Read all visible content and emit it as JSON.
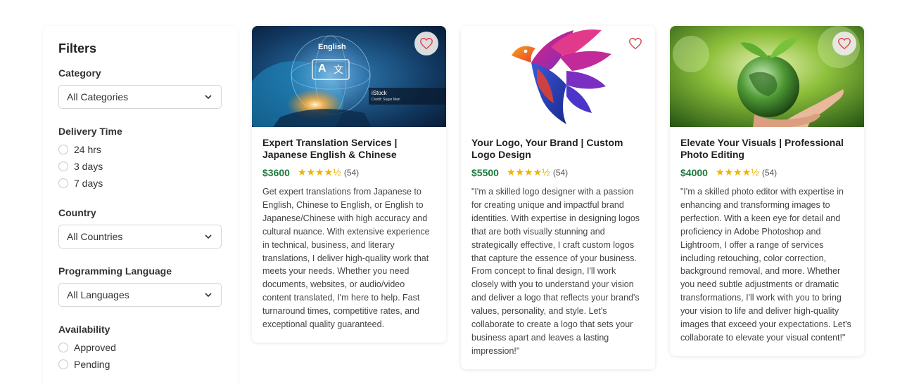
{
  "filters": {
    "title": "Filters",
    "category": {
      "label": "Category",
      "selected": "All Categories"
    },
    "delivery": {
      "label": "Delivery Time",
      "options": [
        "24 hrs",
        "3 days",
        "7 days"
      ]
    },
    "country": {
      "label": "Country",
      "selected": "All Countries"
    },
    "language": {
      "label": "Programming Language",
      "selected": "All Languages"
    },
    "availability": {
      "label": "Availability",
      "options": [
        "Approved",
        "Pending"
      ]
    }
  },
  "cards": [
    {
      "title": "Expert Translation Services | Japanese English & Chinese",
      "price": "$3600",
      "stars": "★★★★½",
      "reviews": "(54)",
      "description": "Get expert translations from Japanese to English, Chinese to English, or English to Japanese/Chinese with high accuracy and cultural nuance. With extensive experience in technical, business, and literary translations, I deliver high-quality work that meets your needs. Whether you need documents, websites, or audio/video content translated, I'm here to help. Fast turnaround times, competitive rates, and exceptional quality guaranteed.",
      "image_text": {
        "english": "English",
        "icon_a": "A",
        "icon_b": "文",
        "stock": "iStock",
        "credit": "Credit: Sugar Man"
      }
    },
    {
      "title": "Your Logo, Your Brand | Custom Logo Design",
      "price": "$5500",
      "stars": "★★★★½",
      "reviews": "(54)",
      "description": "\"I'm a skilled logo designer with a passion for creating unique and impactful brand identities. With expertise in designing logos that are both visually stunning and strategically effective, I craft custom logos that capture the essence of your business. From concept to final design, I'll work closely with you to understand your vision and deliver a logo that reflects your brand's values, personality, and style. Let's collaborate to create a logo that sets your business apart and leaves a lasting impression!\""
    },
    {
      "title": "Elevate Your Visuals | Professional Photo Editing",
      "price": "$4000",
      "stars": "★★★★½",
      "reviews": "(54)",
      "description": "\"I'm a skilled photo editor with expertise in enhancing and transforming images to perfection. With a keen eye for detail and proficiency in Adobe Photoshop and Lightroom, I offer a range of services including retouching, color correction, background removal, and more. Whether you need subtle adjustments or dramatic transformations, I'll work with you to bring your vision to life and deliver high-quality images that exceed your expectations. Let's collaborate to elevate your visual content!\""
    }
  ],
  "colors": {
    "price": "#1e7a3e",
    "star": "#f0b400",
    "heart": "#e0474c"
  }
}
